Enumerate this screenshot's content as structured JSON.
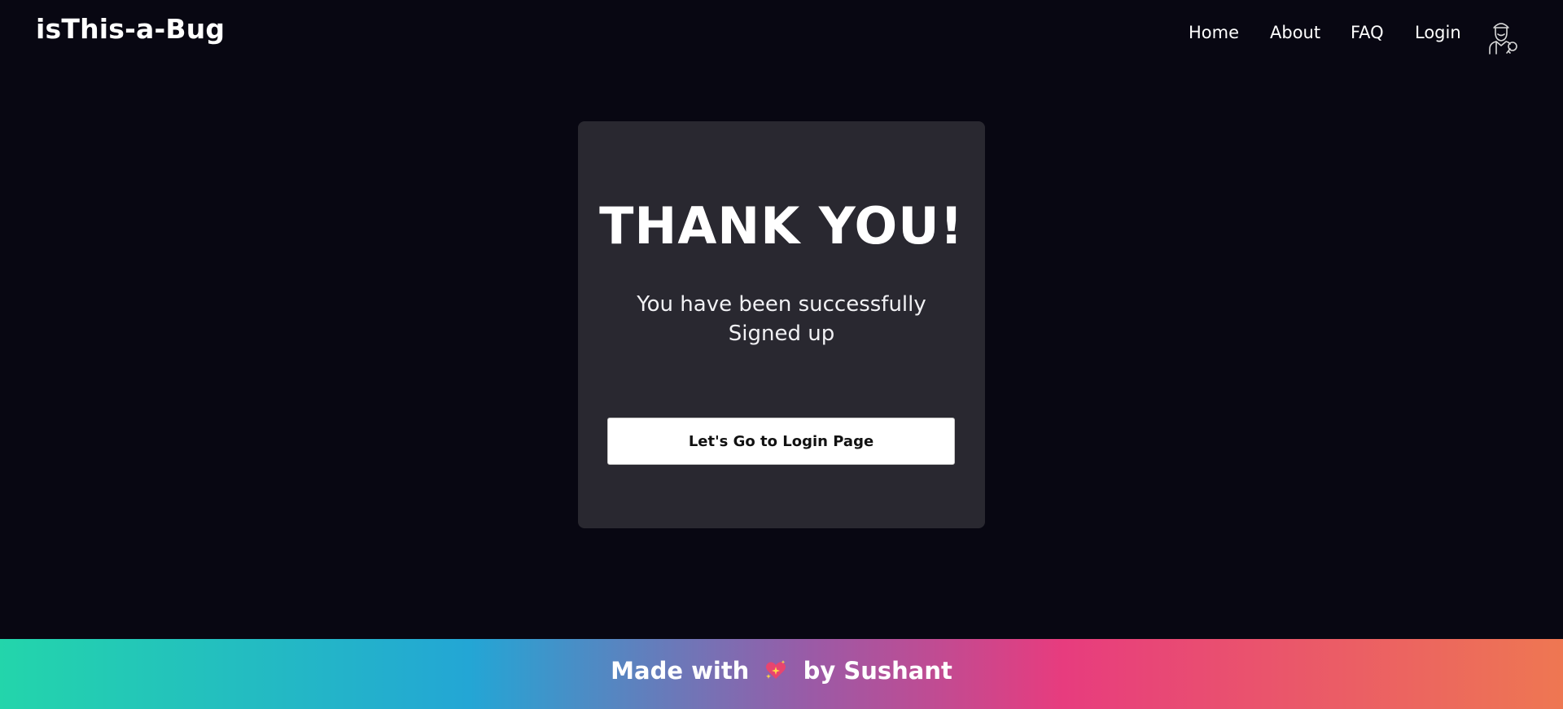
{
  "header": {
    "brand": "isThis-a-Bug",
    "nav": [
      {
        "label": "Home"
      },
      {
        "label": "About"
      },
      {
        "label": "FAQ"
      },
      {
        "label": "Login"
      }
    ],
    "avatar_icon": "user-avatar-icon"
  },
  "card": {
    "title": "THANK YOU!",
    "message_line1": "You have been successfully",
    "message_line2": "Signed up",
    "button_label": "Let's Go to Login Page"
  },
  "footer": {
    "prefix": "Made with",
    "icon": "sparkling-heart-icon",
    "suffix": "by Sushant"
  },
  "colors": {
    "background": "#080712",
    "card": "#292830",
    "gradient": [
      "#23d5ab",
      "#23a6d5",
      "#e73c7e",
      "#ee7752"
    ]
  }
}
